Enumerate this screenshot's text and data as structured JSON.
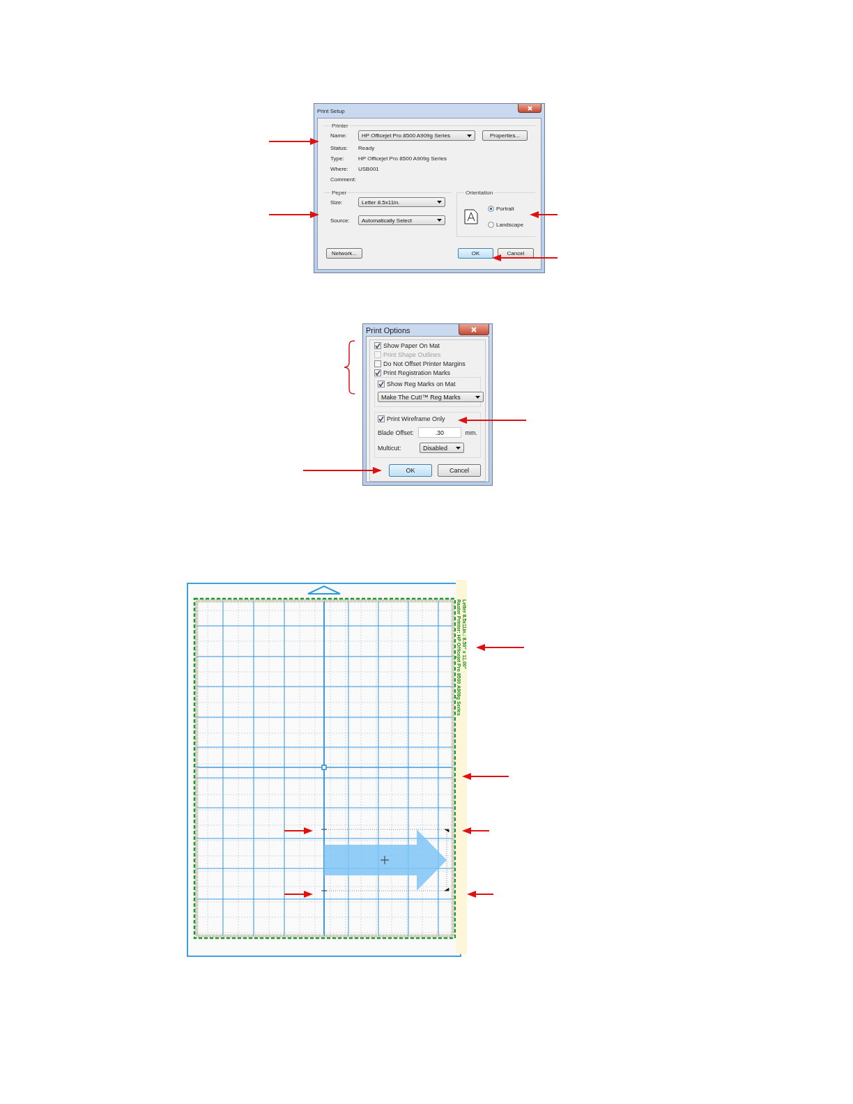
{
  "print_setup": {
    "title": "Print Setup",
    "printer_group": "Printer",
    "name_label": "Name:",
    "printer_name": "HP Officejet Pro 8500 A909g Series",
    "properties_button": "Properties...",
    "info": [
      {
        "label": "Status:",
        "value": "Ready"
      },
      {
        "label": "Type:",
        "value": "HP Officejet Pro 8500 A909g Series"
      },
      {
        "label": "Where:",
        "value": "USB001"
      },
      {
        "label": "Comment:"
      }
    ],
    "paper_group": "Peper",
    "size_label": "Size:",
    "size": "Letter 8.5x11in.",
    "source_label": "Source:",
    "source": "Automatically Select",
    "orientation_group": "Orientation",
    "orientation_options": [
      {
        "label": "Portrait",
        "selected": true
      },
      {
        "label": "Landscape",
        "selected": false
      }
    ],
    "network_button": "Network...",
    "ok_button": "OK",
    "cancel_button": "Cancel"
  },
  "print_options": {
    "title": "Print Options",
    "options": [
      {
        "label": "Show Paper On Mat",
        "checked": true,
        "disabled": false
      },
      {
        "label": "Print Shape Outlines",
        "checked": false,
        "disabled": true
      },
      {
        "label": "Do Not Offset Printer Margins",
        "checked": false,
        "disabled": false
      },
      {
        "label": "Print Registration Marks",
        "checked": true,
        "disabled": false
      },
      {
        "label": "Show Reg Marks on Mat",
        "checked": true,
        "disabled": false
      }
    ],
    "reg_marks_dropdown": "Make The Cut!™ Reg Marks",
    "wireframe": {
      "label": "Print Wireframe Only",
      "checked": true
    },
    "blade_offset_label": "Blade Offset:",
    "blade_offset": ".30",
    "blade_offset_unit": "mm.",
    "multicut_label": "Multicut:",
    "multicut": "Disabled",
    "ok_button": "OK",
    "cancel_button": "Cancel"
  },
  "mat": {
    "paper_label": "Letter 8.5x11in.: 8.50\" x 11.00\"",
    "printer_label": "Raster Printer: HP Officejet Pro 8500 A909g Series"
  }
}
